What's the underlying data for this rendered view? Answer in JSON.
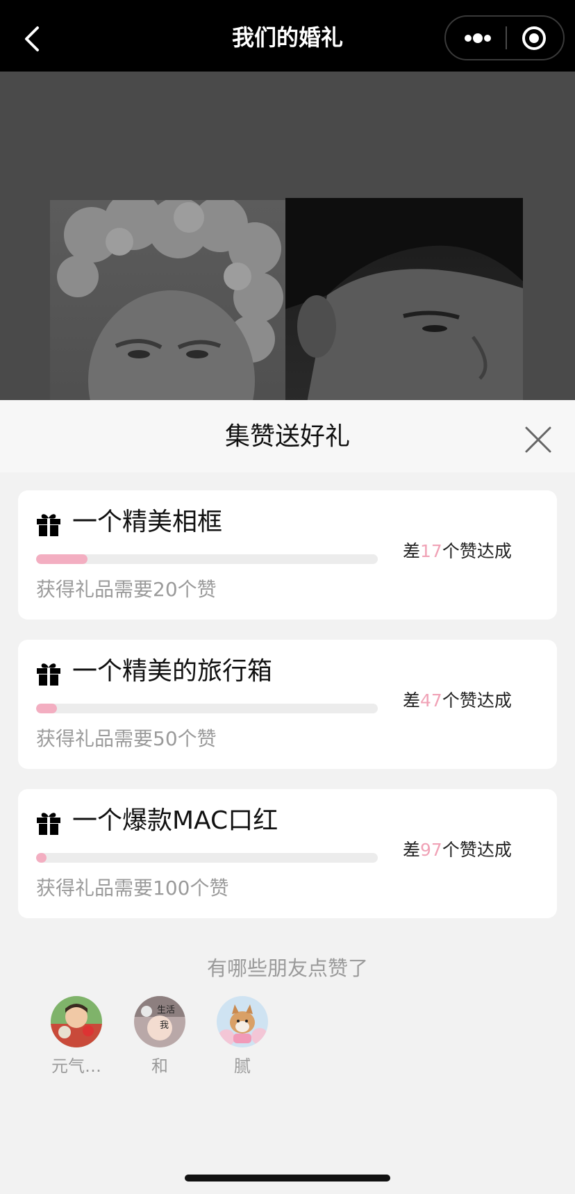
{
  "navbar": {
    "title": "我们的婚礼"
  },
  "sheet": {
    "title": "集赞送好礼"
  },
  "gifts": [
    {
      "title": "一个精美相框",
      "need": "获得礼品需要20个赞",
      "status_prefix": "差",
      "remaining": "17",
      "status_suffix": "个赞达成",
      "progress": 0.15
    },
    {
      "title": "一个精美的旅行箱",
      "need": "获得礼品需要50个赞",
      "status_prefix": "差",
      "remaining": "47",
      "status_suffix": "个赞达成",
      "progress": 0.06
    },
    {
      "title": "一个爆款MAC口红",
      "need": "获得礼品需要100个赞",
      "status_prefix": "差",
      "remaining": "97",
      "status_suffix": "个赞达成",
      "progress": 0.03
    }
  ],
  "friends": {
    "heading": "有哪些朋友点赞了",
    "list": [
      {
        "name": "元气…"
      },
      {
        "name": "和",
        "avatar_text_top": "生活",
        "avatar_text_bottom": "我"
      },
      {
        "name": "腻"
      }
    ]
  },
  "colors": {
    "accent": "#f0a2b6",
    "progress_fill": "#f3aec1",
    "navbar_bg": "#000000"
  },
  "icons": {
    "back": "chevron-left-icon",
    "more": "more-dots-icon",
    "capsule_close": "target-circle-icon",
    "sheet_close": "close-icon",
    "gift": "gift-icon"
  }
}
